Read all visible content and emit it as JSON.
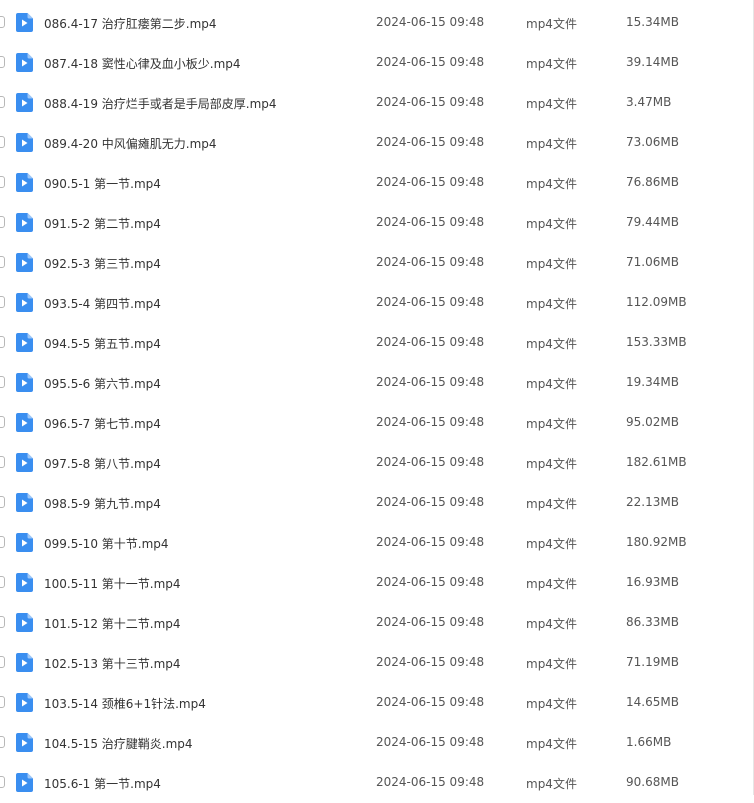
{
  "colors": {
    "icon_blue": "#3a8ef0",
    "icon_fold": "#9cc6f8"
  },
  "file_icon_name": "video-file-icon",
  "files": [
    {
      "name": "086.4-17 治疗肛瘘第二步.mp4",
      "modified": "2024-06-15 09:48",
      "type": "mp4文件",
      "size": "15.34MB"
    },
    {
      "name": "087.4-18 窦性心律及血小板少.mp4",
      "modified": "2024-06-15 09:48",
      "type": "mp4文件",
      "size": "39.14MB"
    },
    {
      "name": "088.4-19 治疗烂手或者是手局部皮厚.mp4",
      "modified": "2024-06-15 09:48",
      "type": "mp4文件",
      "size": "3.47MB"
    },
    {
      "name": "089.4-20 中风偏瘫肌无力.mp4",
      "modified": "2024-06-15 09:48",
      "type": "mp4文件",
      "size": "73.06MB"
    },
    {
      "name": "090.5-1 第一节.mp4",
      "modified": "2024-06-15 09:48",
      "type": "mp4文件",
      "size": "76.86MB"
    },
    {
      "name": "091.5-2 第二节.mp4",
      "modified": "2024-06-15 09:48",
      "type": "mp4文件",
      "size": "79.44MB"
    },
    {
      "name": "092.5-3 第三节.mp4",
      "modified": "2024-06-15 09:48",
      "type": "mp4文件",
      "size": "71.06MB"
    },
    {
      "name": "093.5-4 第四节.mp4",
      "modified": "2024-06-15 09:48",
      "type": "mp4文件",
      "size": "112.09MB"
    },
    {
      "name": "094.5-5 第五节.mp4",
      "modified": "2024-06-15 09:48",
      "type": "mp4文件",
      "size": "153.33MB"
    },
    {
      "name": "095.5-6 第六节.mp4",
      "modified": "2024-06-15 09:48",
      "type": "mp4文件",
      "size": "19.34MB"
    },
    {
      "name": "096.5-7 第七节.mp4",
      "modified": "2024-06-15 09:48",
      "type": "mp4文件",
      "size": "95.02MB"
    },
    {
      "name": "097.5-8 第八节.mp4",
      "modified": "2024-06-15 09:48",
      "type": "mp4文件",
      "size": "182.61MB"
    },
    {
      "name": "098.5-9 第九节.mp4",
      "modified": "2024-06-15 09:48",
      "type": "mp4文件",
      "size": "22.13MB"
    },
    {
      "name": "099.5-10 第十节.mp4",
      "modified": "2024-06-15 09:48",
      "type": "mp4文件",
      "size": "180.92MB"
    },
    {
      "name": "100.5-11 第十一节.mp4",
      "modified": "2024-06-15 09:48",
      "type": "mp4文件",
      "size": "16.93MB"
    },
    {
      "name": "101.5-12 第十二节.mp4",
      "modified": "2024-06-15 09:48",
      "type": "mp4文件",
      "size": "86.33MB"
    },
    {
      "name": "102.5-13 第十三节.mp4",
      "modified": "2024-06-15 09:48",
      "type": "mp4文件",
      "size": "71.19MB"
    },
    {
      "name": "103.5-14 颈椎6+1针法.mp4",
      "modified": "2024-06-15 09:48",
      "type": "mp4文件",
      "size": "14.65MB"
    },
    {
      "name": "104.5-15 治疗腱鞘炎.mp4",
      "modified": "2024-06-15 09:48",
      "type": "mp4文件",
      "size": "1.66MB"
    },
    {
      "name": "105.6-1 第一节.mp4",
      "modified": "2024-06-15 09:48",
      "type": "mp4文件",
      "size": "90.68MB"
    }
  ]
}
